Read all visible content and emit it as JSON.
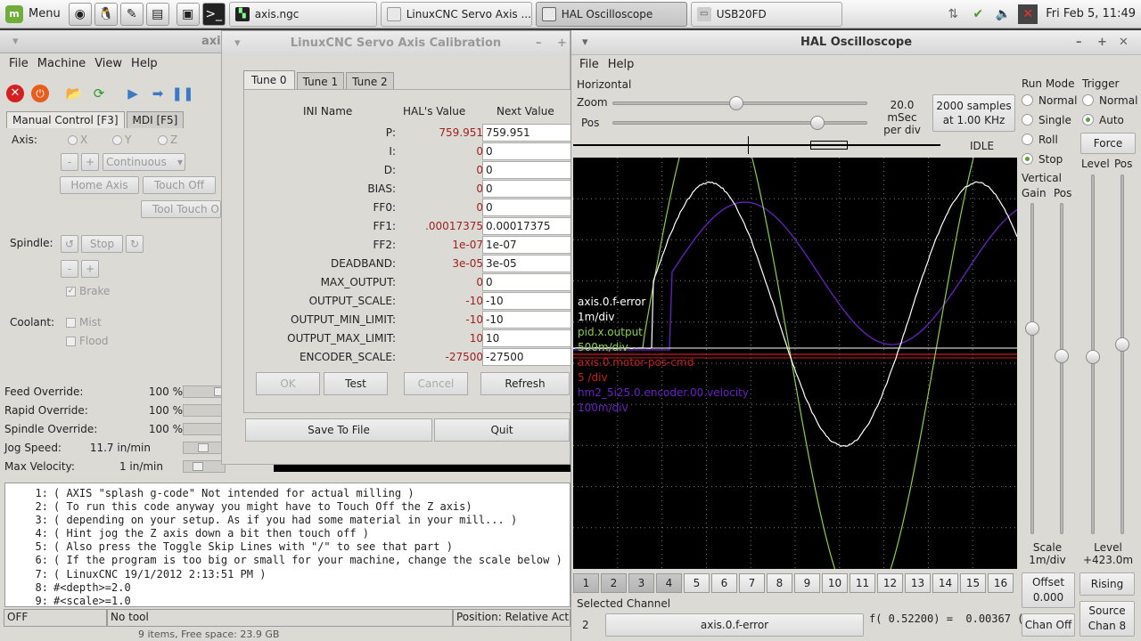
{
  "taskbar": {
    "menu_label": "Menu",
    "tasks": [
      {
        "label": "axis.ngc"
      },
      {
        "label": "LinuxCNC Servo Axis ..."
      },
      {
        "label": "HAL Oscilloscope"
      },
      {
        "label": "USB20FD"
      }
    ],
    "clock": "Fri Feb 5, 11:49"
  },
  "axis": {
    "title": "axi",
    "menu": [
      "File",
      "Machine",
      "View",
      "Help"
    ],
    "tabs": [
      "Manual Control [F3]",
      "MDI [F5]"
    ],
    "axis_label": "Axis:",
    "axes": [
      "X",
      "Y",
      "Z"
    ],
    "jog_minus": "-",
    "jog_plus": "+",
    "jog_mode": "Continuous",
    "home_axis": "Home Axis",
    "touch_off": "Touch Off",
    "tool_touch": "Tool Touch O",
    "spindle_label": "Spindle:",
    "spindle_stop": "Stop",
    "brake": "Brake",
    "coolant_label": "Coolant:",
    "mist": "Mist",
    "flood": "Flood",
    "overrides": [
      {
        "label": "Feed Override:",
        "value": "100 %"
      },
      {
        "label": "Rapid Override:",
        "value": "100 %"
      },
      {
        "label": "Spindle Override:",
        "value": "100 %"
      },
      {
        "label": "Jog Speed:",
        "value": "11.7 in/min"
      },
      {
        "label": "Max Velocity:",
        "value": "1 in/min"
      }
    ],
    "gcode": [
      {
        "n": "1:",
        "text": "( AXIS \"splash g-code\" Not intended for actual milling )"
      },
      {
        "n": "2:",
        "text": "( To run this code anyway you might have to Touch Off the Z axis)"
      },
      {
        "n": "3:",
        "text": "( depending on your setup. As if you had some material in your mill... )"
      },
      {
        "n": "4:",
        "text": "( Hint jog the Z axis down a bit then touch off )"
      },
      {
        "n": "5:",
        "text": "( Also press the Toggle Skip Lines with \"/\" to see that part )"
      },
      {
        "n": "6:",
        "text": "( If the program is too big or small for your machine, change the scale below )"
      },
      {
        "n": "7:",
        "text": "( LinuxCNC 19/1/2012 2:13:51 PM )"
      },
      {
        "n": "8:",
        "text": "#<depth>=2.0"
      },
      {
        "n": "9:",
        "text": "#<scale>=1.0"
      }
    ],
    "status": {
      "state": "OFF",
      "tool": "No tool",
      "position": "Position: Relative Actu"
    },
    "bottom_text": "9 items, Free space: 23.9 GB"
  },
  "servo": {
    "title": "LinuxCNC Servo Axis Calibration",
    "tabs": [
      "Tune 0",
      "Tune 1",
      "Tune 2"
    ],
    "headers": {
      "ini": "INI Name",
      "hal": "HAL's Value",
      "next": "Next Value"
    },
    "params": [
      {
        "name": "P:",
        "hal": "759.951",
        "next": "759.951"
      },
      {
        "name": "I:",
        "hal": "0",
        "next": "0"
      },
      {
        "name": "D:",
        "hal": "0",
        "next": "0"
      },
      {
        "name": "BIAS:",
        "hal": "0",
        "next": "0"
      },
      {
        "name": "FF0:",
        "hal": "0",
        "next": "0"
      },
      {
        "name": "FF1:",
        "hal": ".00017375",
        "next": "0.00017375"
      },
      {
        "name": "FF2:",
        "hal": "1e-07",
        "next": "1e-07"
      },
      {
        "name": "DEADBAND:",
        "hal": "3e-05",
        "next": "3e-05"
      },
      {
        "name": "MAX_OUTPUT:",
        "hal": "0",
        "next": "0"
      },
      {
        "name": "OUTPUT_SCALE:",
        "hal": "-10",
        "next": "-10"
      },
      {
        "name": "OUTPUT_MIN_LIMIT:",
        "hal": "-10",
        "next": "-10"
      },
      {
        "name": "OUTPUT_MAX_LIMIT:",
        "hal": "10",
        "next": "10"
      },
      {
        "name": "ENCODER_SCALE:",
        "hal": "-27500",
        "next": "-27500"
      }
    ],
    "buttons": {
      "ok": "OK",
      "test": "Test",
      "cancel": "Cancel",
      "refresh": "Refresh",
      "save": "Save To File",
      "quit": "Quit"
    }
  },
  "osc": {
    "title": "HAL Oscilloscope",
    "menu": [
      "File",
      "Help"
    ],
    "horizontal": "Horizontal",
    "zoom": "Zoom",
    "pos": "Pos",
    "zoom_level": 0.48,
    "pos_level": 0.82,
    "time_div": "20.0 mSec",
    "per_div": "per div",
    "samples": "2000 samples",
    "rate": "at 1.00 KHz",
    "state": "IDLE",
    "run_mode": {
      "label": "Run Mode",
      "options": [
        "Normal",
        "Single",
        "Roll",
        "Stop"
      ],
      "selected": "Stop"
    },
    "trigger": {
      "label": "Trigger",
      "options": [
        "Normal",
        "Auto"
      ],
      "selected": "Auto",
      "force": "Force"
    },
    "vertical": "Vertical",
    "gain": "Gain",
    "vpos": "Pos",
    "level": "Level",
    "tpos": "Pos",
    "channels": [
      {
        "name": "axis.0.f-error",
        "scale": "1m/div",
        "color": "#ffffff"
      },
      {
        "name": "pid.x.output",
        "scale": "500m/div",
        "color": "#8cd23c"
      },
      {
        "name": "axis.0.motor-pos-cmd",
        "scale": "5 /div",
        "color": "#c81e1e"
      },
      {
        "name": "hm2_5i25.0.encoder.00.velocity",
        "scale": "100m/div",
        "color": "#6a1fc8"
      }
    ],
    "channel_buttons": [
      "1",
      "2",
      "3",
      "4",
      "5",
      "6",
      "7",
      "8",
      "9",
      "10",
      "11",
      "12",
      "13",
      "14",
      "15",
      "16"
    ],
    "active_channels": [
      "1",
      "2",
      "3",
      "4"
    ],
    "scale_label": "Scale",
    "scale_value": "1m/div",
    "level_label": "Level",
    "level_value": "+423.0m",
    "offset_label": "Offset",
    "offset_value": "0.000",
    "rising": "Rising",
    "chan_off": "Chan Off",
    "source_label": "Source",
    "source_value": "Chan 8",
    "selected_channel_label": "Selected Channel",
    "selected_channel_num": "2",
    "selected_channel_name": "axis.0.f-error",
    "readout": "f( 0.52200) =  0.00367 ("
  }
}
